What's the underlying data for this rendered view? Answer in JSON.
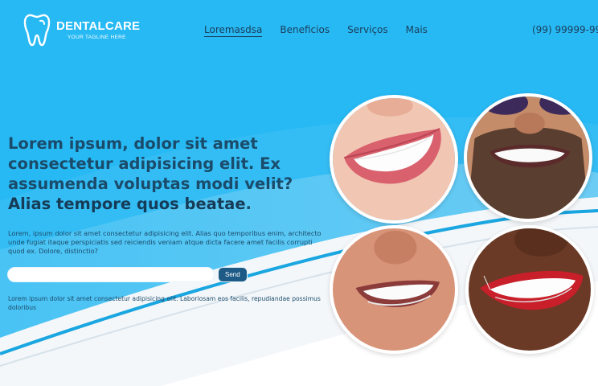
{
  "brand": {
    "name_part1": "DENTAL",
    "name_part2": "CARE",
    "tagline": "YOUR TAGLINE HERE",
    "logo_icon": "tooth-icon"
  },
  "nav": {
    "items": [
      {
        "label": "Loremasdsa",
        "active": true
      },
      {
        "label": "Beneficios",
        "active": false
      },
      {
        "label": "Serviços",
        "active": false
      },
      {
        "label": "Mais",
        "active": false
      }
    ],
    "phone": "(99) 99999-99"
  },
  "hero": {
    "headline_regular": "Lorem ipsum, dolor sit amet consectetur adipisicing elit. Ex assumenda voluptas modi velit? ",
    "headline_bold": "Alias tempore quos beatae",
    "headline_end": ".",
    "description": "Lorem, ipsum dolor sit amet consectetur adipisicing elit. Alias quo temporibus enim, architecto unde fugiat itaque perspiciatis sed reiciendis veniam atque dicta facere amet facilis corrupti quod ex. Dolore, distinctio?",
    "input_value": "",
    "input_placeholder": "",
    "send_label": "Send",
    "note": "Lorem ipsum dolor sit amet consectetur adipisicing elit. Laboriosam eos facilis, repudiandae possimus doloribus"
  },
  "colors": {
    "background": "#27b9f4",
    "text_dark": "#1b4b6a",
    "button": "#1d5a86"
  }
}
